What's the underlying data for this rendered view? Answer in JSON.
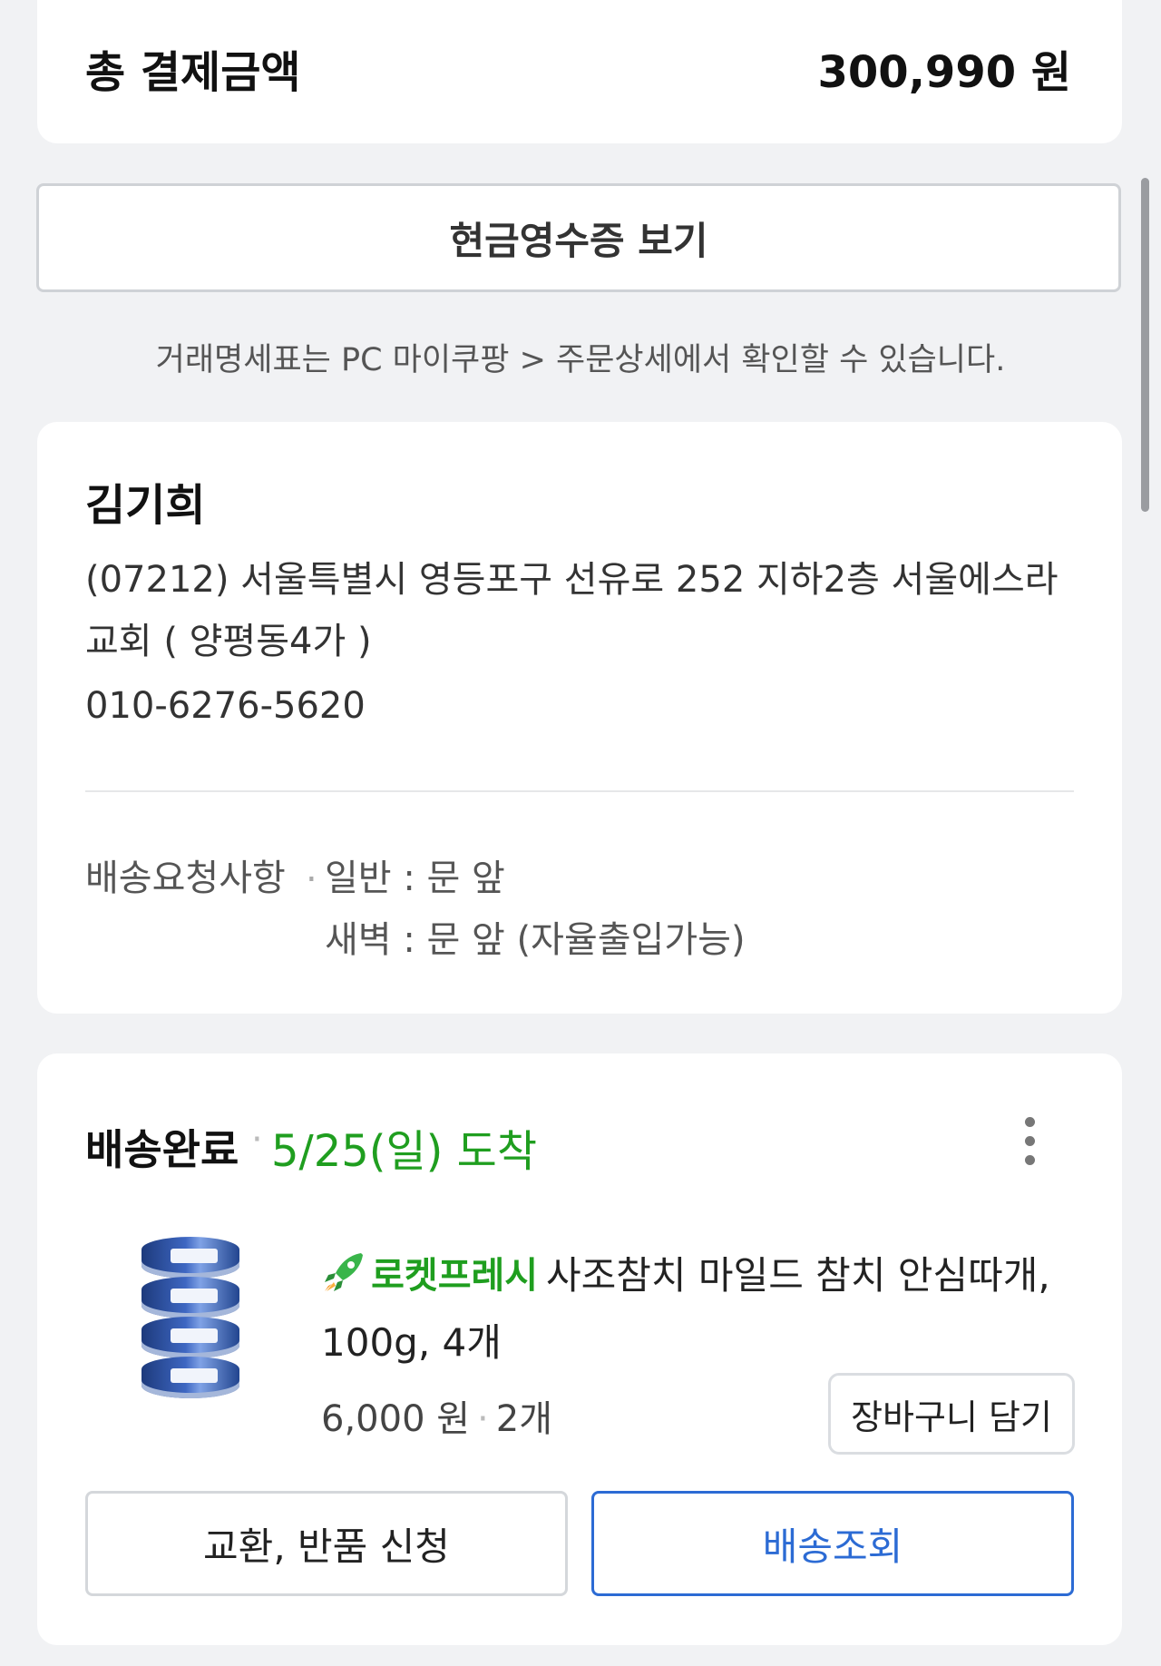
{
  "payment": {
    "total_label": "총 결제금액",
    "total_amount": "300,990 원"
  },
  "receipt": {
    "button_label": "현금영수증 보기",
    "note": "거래명세표는 PC 마이쿠팡 > 주문상세에서 확인할 수 있습니다."
  },
  "address": {
    "name": "김기희",
    "address": "(07212) 서울특별시 영등포구 선유로 252 지하2층 서울에스라 교회 ( 양평동4가 )",
    "phone": "010-6276-5620",
    "request_label": "배송요청사항",
    "request_general": "일반 : 문 앞",
    "request_dawn": "새벽 : 문 앞 (자율출입가능)"
  },
  "order": {
    "status": "배송완료",
    "arrival": "5/25(일) 도착",
    "more_icon": "more-vertical-icon",
    "product": {
      "badge": "로켓프레시",
      "badge_icon": "rocket-icon",
      "title": "사조참치 마일드 참치 안심따개, 100g, 4개",
      "price": "6,000 원",
      "quantity": "2개"
    },
    "cart_button": "장바구니 담기",
    "return_button": "교환, 반품 신청",
    "track_button": "배송조회"
  },
  "colors": {
    "accent_green": "#1f9e1f",
    "accent_blue": "#2c6bd4",
    "background": "#f1f2f4"
  }
}
